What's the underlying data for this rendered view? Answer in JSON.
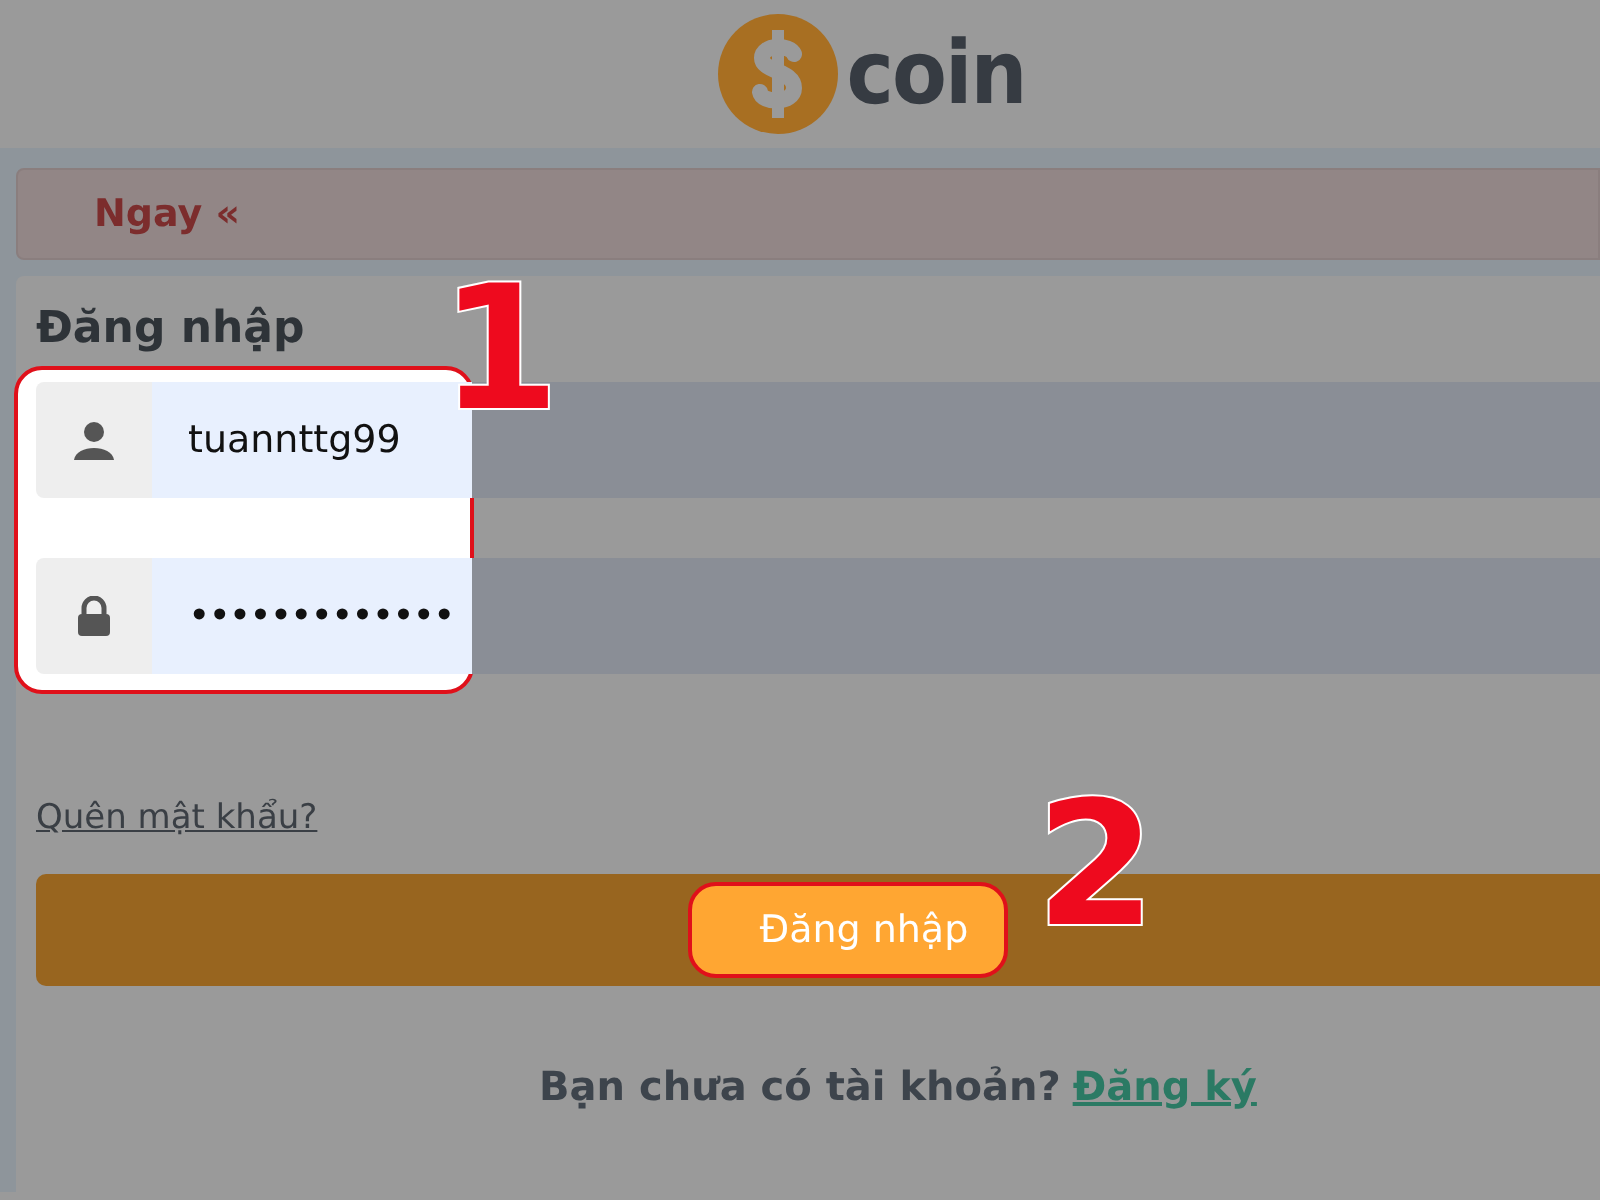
{
  "logo": {
    "text": "coin"
  },
  "alert": {
    "text": "Ngay «"
  },
  "login": {
    "title": "Đăng nhập",
    "fields": [
      {
        "kind": "text",
        "value": "tuannttg99"
      },
      {
        "kind": "password",
        "value": "•••••••••••••"
      }
    ],
    "forgot_link": "Quên mật khẩu?",
    "submit_button": "Đăng nhập",
    "signup": {
      "prompt": "Bạn chưa có tài khoản?",
      "link": "Đăng ký"
    }
  },
  "annotations": [
    {
      "label": "1"
    },
    {
      "label": "2"
    }
  ]
}
